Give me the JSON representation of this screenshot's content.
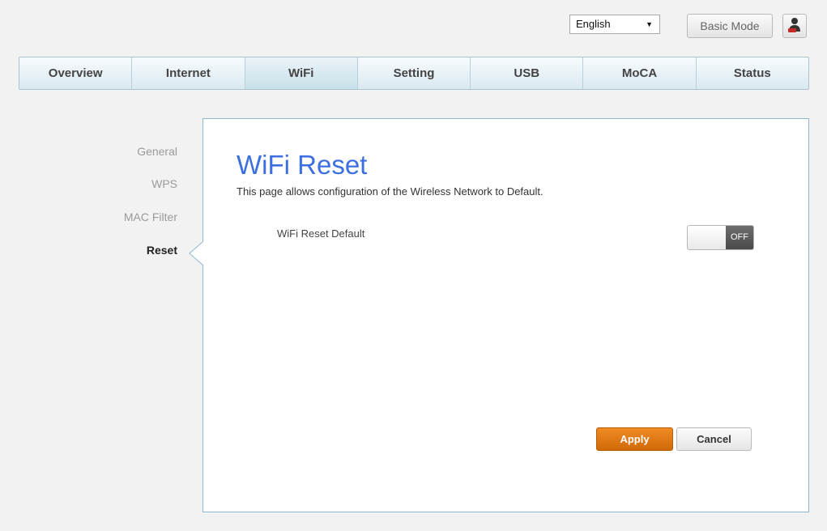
{
  "topbar": {
    "language": "English",
    "basic_mode_label": "Basic Mode",
    "user_icon": "user-icon"
  },
  "nav": {
    "tabs": [
      {
        "label": "Overview",
        "active": false
      },
      {
        "label": "Internet",
        "active": false
      },
      {
        "label": "WiFi",
        "active": true
      },
      {
        "label": "Setting",
        "active": false
      },
      {
        "label": "USB",
        "active": false
      },
      {
        "label": "MoCA",
        "active": false
      },
      {
        "label": "Status",
        "active": false
      }
    ]
  },
  "sidebar": {
    "items": [
      {
        "label": "General",
        "active": false
      },
      {
        "label": "WPS",
        "active": false
      },
      {
        "label": "MAC Filter",
        "active": false
      },
      {
        "label": "Reset",
        "active": true
      }
    ]
  },
  "panel": {
    "title": "WiFi Reset",
    "description": "This page allows configuration of the Wireless Network to Default.",
    "field_label": "WiFi Reset Default",
    "toggle_state": "OFF",
    "apply_label": "Apply",
    "cancel_label": "Cancel"
  },
  "colors": {
    "title": "#3d6fe0",
    "apply": "#e07b13",
    "panel_border": "#8fb8cc"
  }
}
